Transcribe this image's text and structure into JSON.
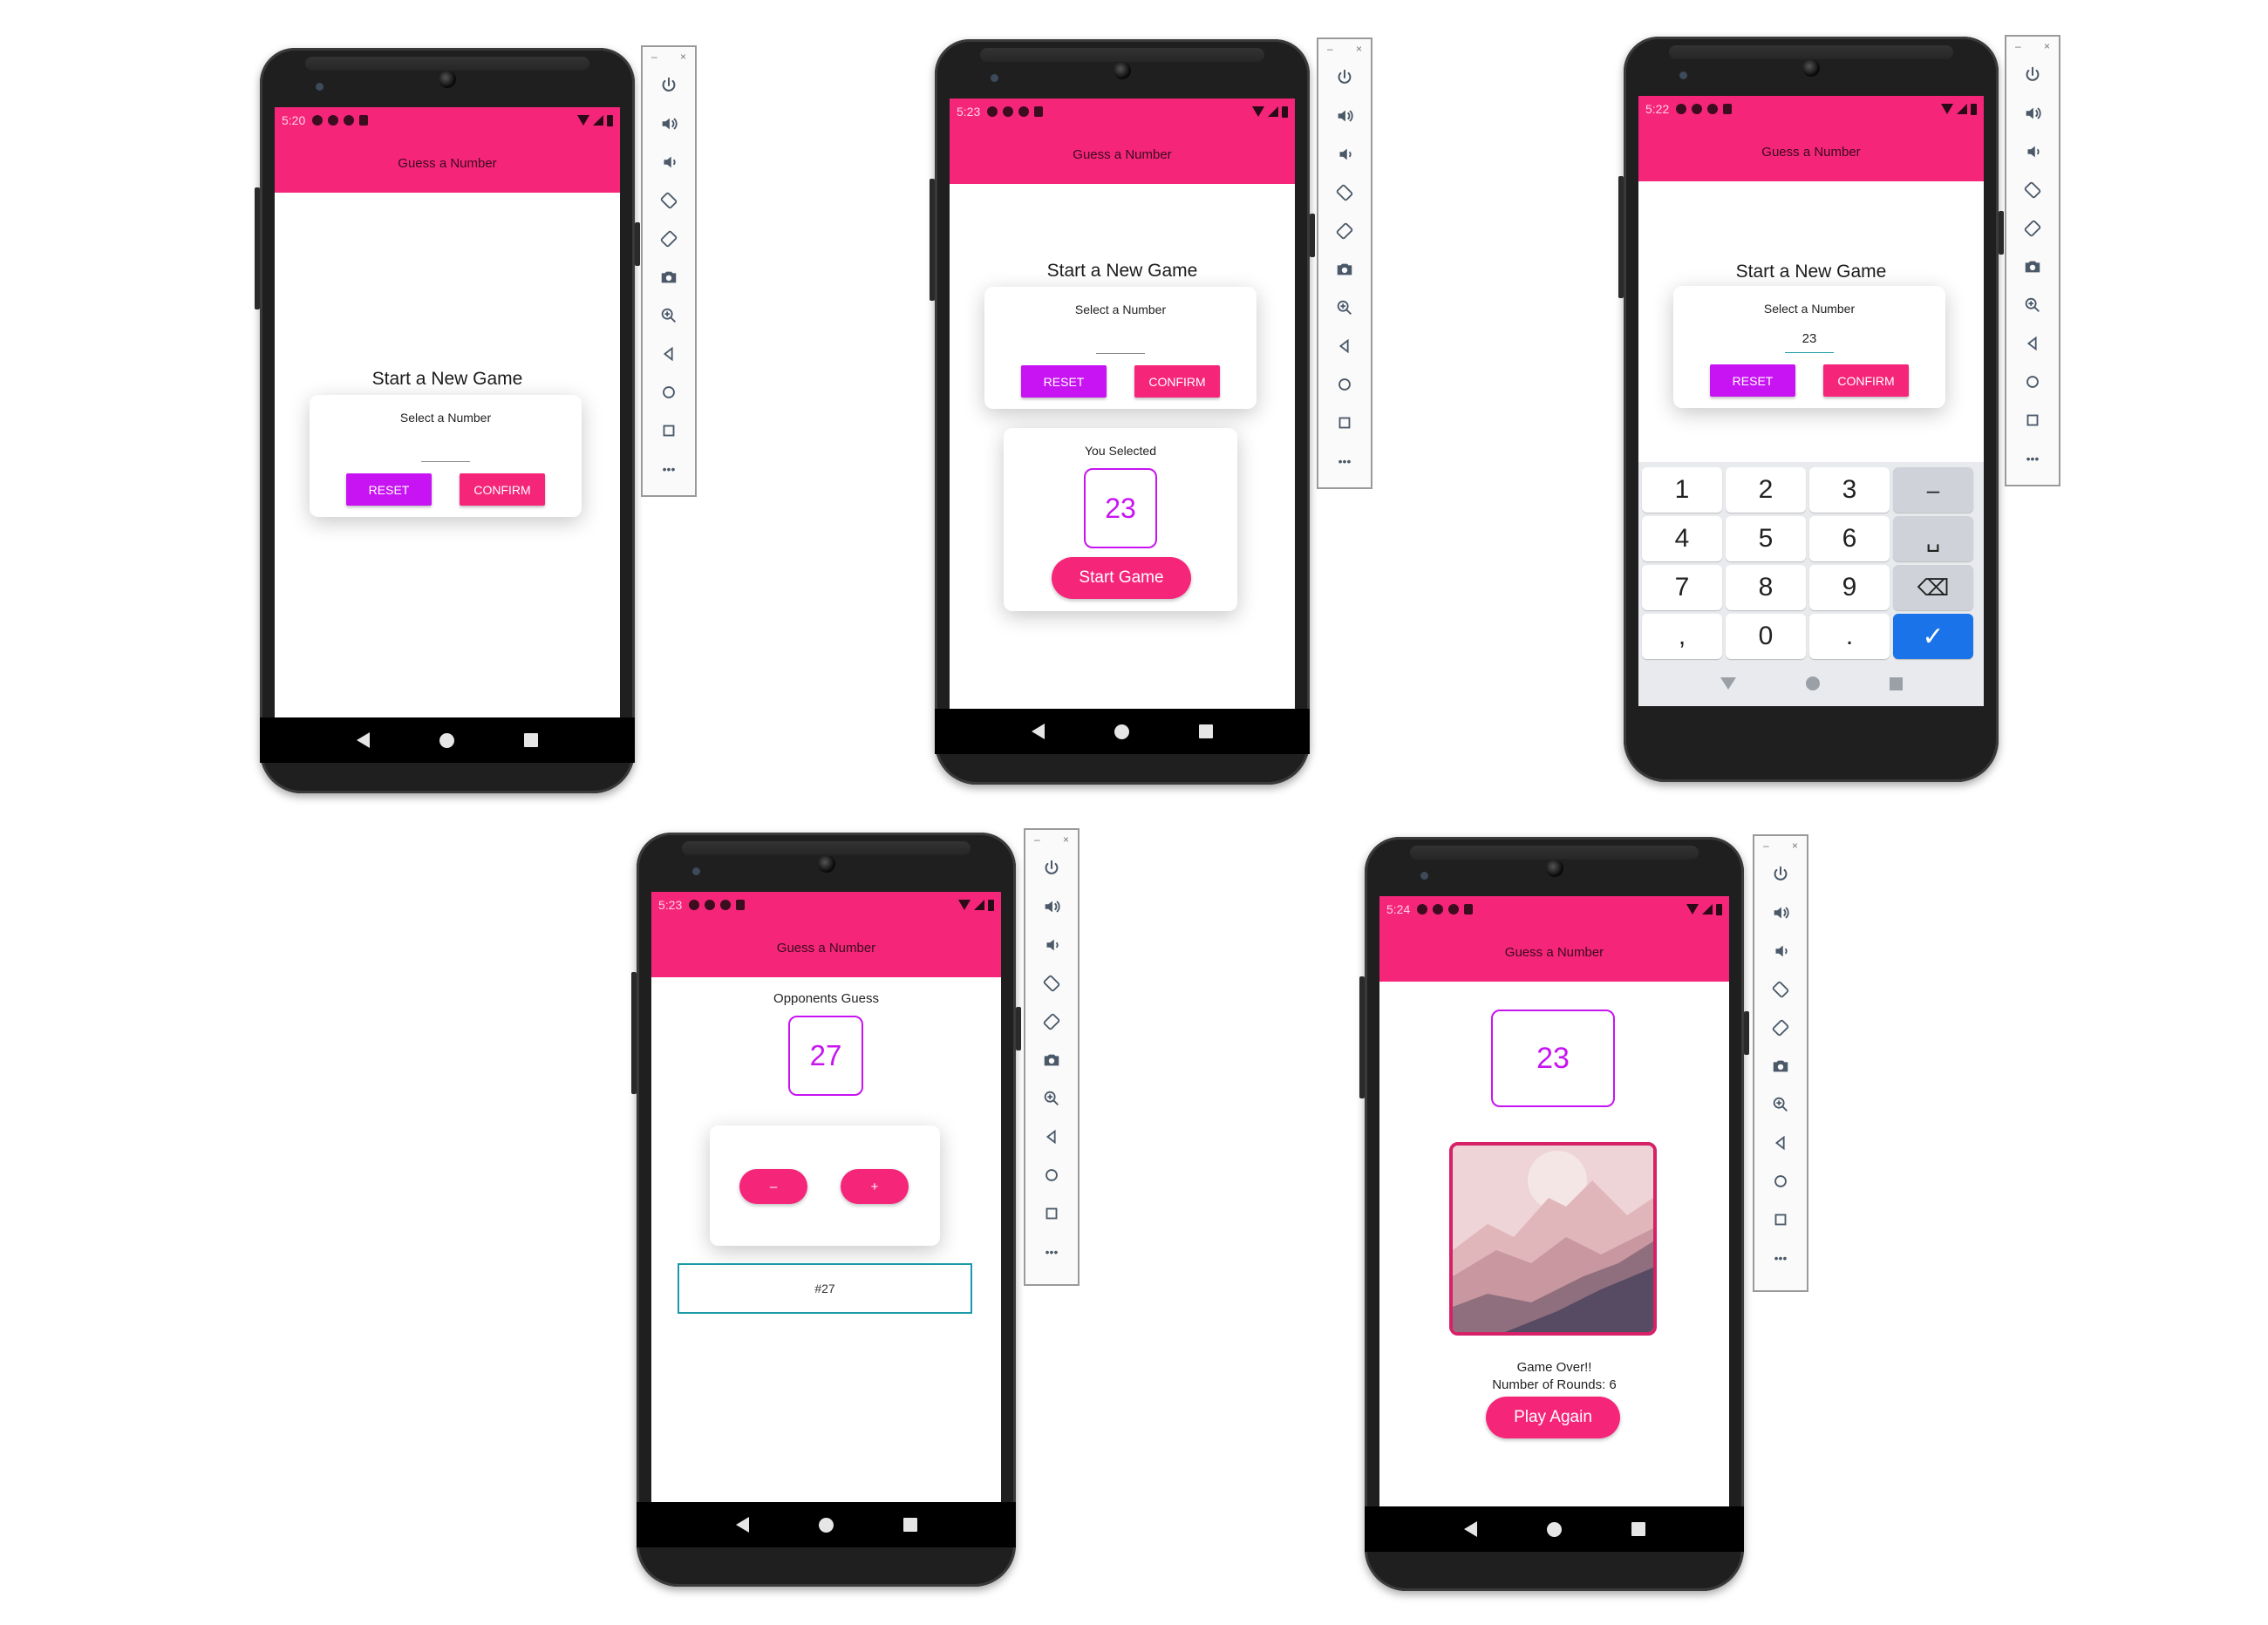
{
  "app": {
    "title": "Guess a Number"
  },
  "colors": {
    "primary": "#f5257a",
    "accent": "#c814f2"
  },
  "emulator_toolbar": {
    "window_controls": [
      "–",
      "×"
    ],
    "buttons": [
      "power-icon",
      "volume-up-icon",
      "volume-down-icon",
      "rotate-left-icon",
      "rotate-right-icon",
      "camera-icon",
      "zoom-icon",
      "back-icon",
      "home-icon",
      "overview-icon",
      "more-icon"
    ],
    "more_label": "•••"
  },
  "screens": [
    {
      "time": "5:20",
      "title": "Start a New Game",
      "select_label": "Select a Number",
      "reset": "RESET",
      "confirm": "CONFIRM"
    },
    {
      "time": "5:23",
      "title": "Start a New Game",
      "select_label": "Select a Number",
      "reset": "RESET",
      "confirm": "CONFIRM",
      "selected_label": "You Selected",
      "selected_value": "23",
      "start_button": "Start Game"
    },
    {
      "time": "5:22",
      "title": "Start a New Game",
      "select_label": "Select a Number",
      "input_value": "23",
      "reset": "RESET",
      "confirm": "CONFIRM",
      "keys": [
        "1",
        "2",
        "3",
        "–",
        "4",
        "5",
        "6",
        "␣",
        "7",
        "8",
        "9",
        "⌫",
        ",",
        "0",
        ".",
        "✓"
      ]
    },
    {
      "time": "5:23",
      "opponent_label": "Opponents Guess",
      "opponent_value": "27",
      "minus": "–",
      "plus": "+",
      "log_entry": "#27"
    },
    {
      "time": "5:24",
      "number": "23",
      "game_over": "Game Over!!",
      "rounds": "Number of Rounds: 6",
      "play_again": "Play Again"
    }
  ]
}
